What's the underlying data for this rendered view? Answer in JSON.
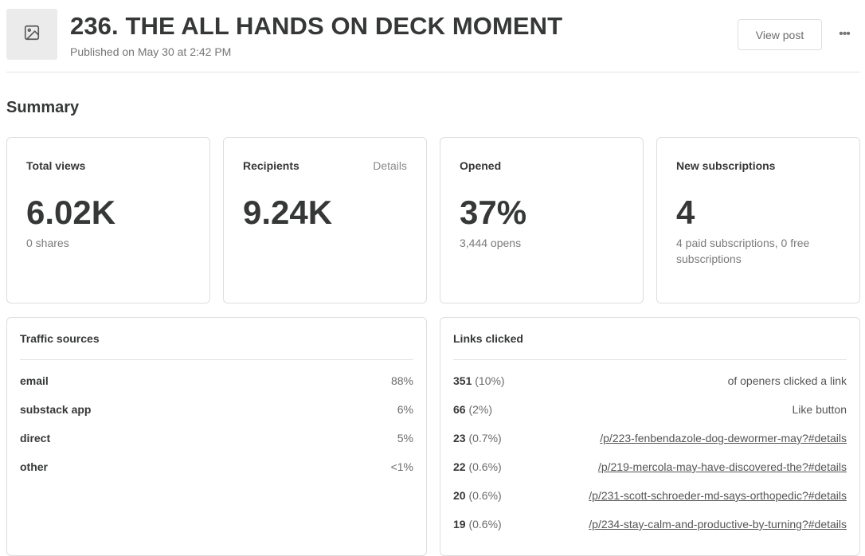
{
  "post": {
    "title": "236. THE ALL HANDS ON DECK MOMENT",
    "published": "Published on May 30 at 2:42 PM",
    "view_post_label": "View post",
    "more_label": "•••",
    "thumbnail_icon": "image-icon"
  },
  "summary": {
    "heading": "Summary",
    "cards": [
      {
        "label": "Total views",
        "value": "6.02K",
        "sub": "0 shares"
      },
      {
        "label": "Recipients",
        "value": "9.24K",
        "details": "Details"
      },
      {
        "label": "Opened",
        "value": "37%",
        "sub": "3,444 opens"
      },
      {
        "label": "New subscriptions",
        "value": "4",
        "sub": "4 paid subscriptions, 0 free subscriptions"
      }
    ]
  },
  "traffic": {
    "title": "Traffic sources",
    "rows": [
      {
        "name": "email",
        "pct": "88%"
      },
      {
        "name": "substack app",
        "pct": "6%"
      },
      {
        "name": "direct",
        "pct": "5%"
      },
      {
        "name": "other",
        "pct": "<1%"
      }
    ]
  },
  "links": {
    "title": "Links clicked",
    "rows": [
      {
        "count": "351",
        "pct": "(10%)",
        "label": "of openers clicked a link",
        "is_link": false
      },
      {
        "count": "66",
        "pct": "(2%)",
        "label": "Like button",
        "is_link": false
      },
      {
        "count": "23",
        "pct": "(0.7%)",
        "label": "/p/223-fenbendazole-dog-dewormer-may?#details",
        "is_link": true
      },
      {
        "count": "22",
        "pct": "(0.6%)",
        "label": "/p/219-mercola-may-have-discovered-the?#details",
        "is_link": true
      },
      {
        "count": "20",
        "pct": "(0.6%)",
        "label": "/p/231-scott-schroeder-md-says-orthopedic?#details",
        "is_link": true
      },
      {
        "count": "19",
        "pct": "(0.6%)",
        "label": "/p/234-stay-calm-and-productive-by-turning?#details",
        "is_link": true
      }
    ]
  }
}
